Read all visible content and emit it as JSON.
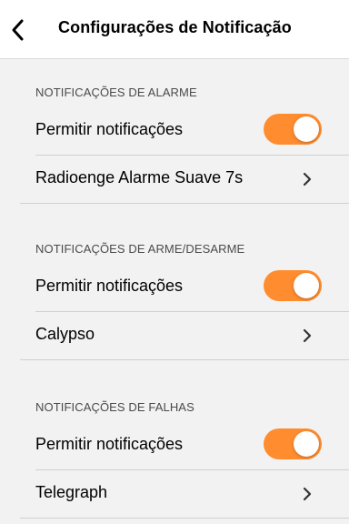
{
  "header": {
    "title": "Configurações de Notificação",
    "back_icon": "chevron-left-icon"
  },
  "colors": {
    "toggle_on": "#ff8c2e",
    "background": "#f2f2f2",
    "divider": "#d0d0d0"
  },
  "sections": [
    {
      "title": "NOTIFICAÇÕES DE ALARME",
      "allow_label": "Permitir notificações",
      "allow_enabled": true,
      "sound_label": "Radioenge Alarme Suave 7s"
    },
    {
      "title": "NOTIFICAÇÕES DE ARME/DESARME",
      "allow_label": "Permitir notificações",
      "allow_enabled": true,
      "sound_label": "Calypso"
    },
    {
      "title": "NOTIFICAÇÕES DE FALHAS",
      "allow_label": "Permitir notificações",
      "allow_enabled": true,
      "sound_label": "Telegraph"
    }
  ]
}
